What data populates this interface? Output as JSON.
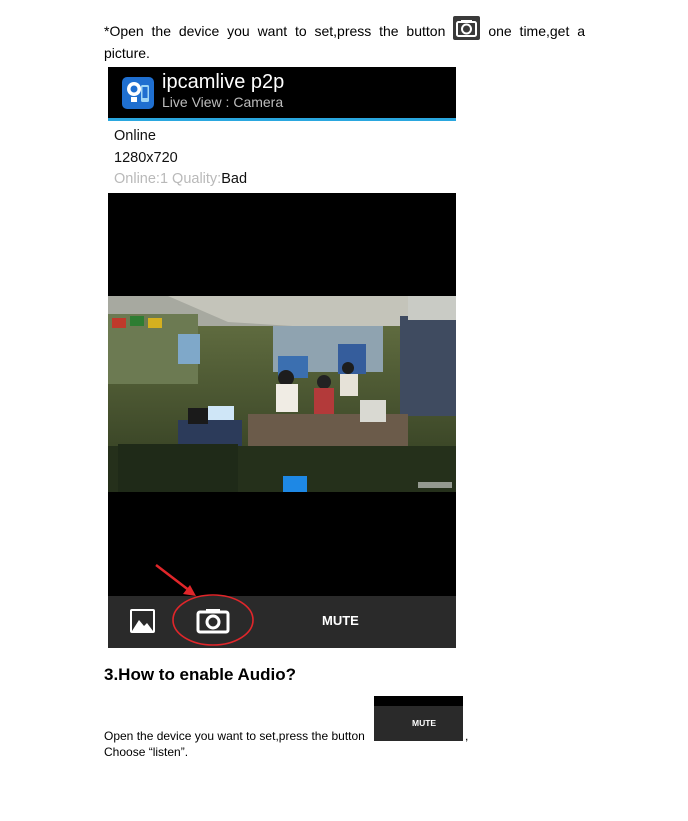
{
  "instruction1": {
    "star": "*",
    "before": "Open the device you want to set,press the button",
    "after": "one time,get a picture."
  },
  "phone": {
    "app_title": "ipcamlive p2p",
    "app_subtitle": "Live View : Camera",
    "status_line1": "Online",
    "status_line2": "1280x720",
    "status_line3_faded": "Online:1 Quality:",
    "status_line3_value": "Bad",
    "mute_label": "MUTE"
  },
  "section": {
    "heading": "3.How to enable Audio?",
    "para_before": "Open the device you want to set,press the button",
    "para_after": ",",
    "para_line2": "Choose “listen”.",
    "thumb_label": "MUTE"
  },
  "colors": {
    "accent_blue": "#2aa7df",
    "annotation_red": "#e0262a",
    "bar_dark": "#2a2a2a"
  }
}
